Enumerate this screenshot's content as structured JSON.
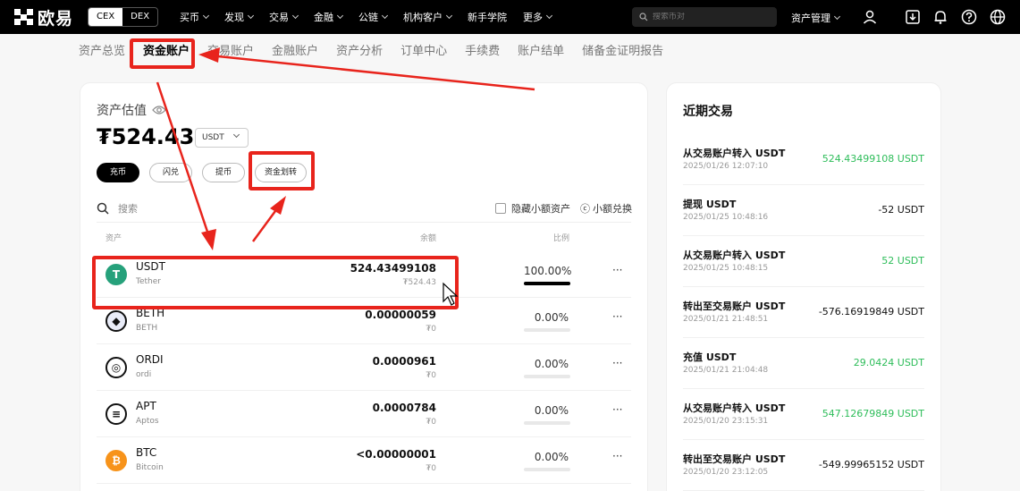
{
  "header": {
    "logo_text": "欧易",
    "cex_label": "CEX",
    "dex_label": "DEX",
    "nav": [
      "买币",
      "发现",
      "交易",
      "金融",
      "公链",
      "机构客户",
      "新手学院",
      "更多"
    ],
    "search_placeholder": "搜索币对",
    "asset_mgmt": "资产管理"
  },
  "subnav": [
    "资产总览",
    "资金账户",
    "交易账户",
    "金融账户",
    "资产分析",
    "订单中心",
    "手续费",
    "账户结单",
    "储备金证明报告"
  ],
  "subnav_active": "资金账户",
  "valuation": {
    "label": "资产估值",
    "amount": "₮524.43",
    "unit": "USDT"
  },
  "actions": {
    "deposit": "充币",
    "swap": "闪兑",
    "withdraw": "提币",
    "transfer": "资金划转"
  },
  "filters": {
    "search_placeholder": "搜索",
    "hide_small": "隐藏小额资产",
    "small_convert": "小额兑换"
  },
  "table": {
    "headers": [
      "资产",
      "余额",
      "比例"
    ],
    "rows": [
      {
        "symbol": "USDT",
        "name": "Tether",
        "amount": "524.43499108",
        "fiat": "₮524.43",
        "percent": "100.00%",
        "fill": 1.0,
        "color": "#26a17b",
        "glyph": "T",
        "icon": "tether-icon"
      },
      {
        "symbol": "BETH",
        "name": "BETH",
        "amount": "0.00000059",
        "fiat": "₮0",
        "percent": "0.00%",
        "fill": 0,
        "color": "#e9ecf8",
        "glyph": "◆",
        "icon": "eth-icon"
      },
      {
        "symbol": "ORDI",
        "name": "ordi",
        "amount": "0.0000961",
        "fiat": "₮0",
        "percent": "0.00%",
        "fill": 0,
        "color": "#ffffff",
        "glyph": "◎",
        "icon": "ordi-icon"
      },
      {
        "symbol": "APT",
        "name": "Aptos",
        "amount": "0.0000784",
        "fiat": "₮0",
        "percent": "0.00%",
        "fill": 0,
        "color": "#ffffff",
        "glyph": "≡",
        "icon": "aptos-icon"
      },
      {
        "symbol": "BTC",
        "name": "Bitcoin",
        "amount": "<0.00000001",
        "fiat": "₮0",
        "percent": "0.00%",
        "fill": 0,
        "color": "#f7931a",
        "glyph": "₿",
        "icon": "bitcoin-icon"
      }
    ],
    "more": "···"
  },
  "recent": {
    "title": "近期交易",
    "items": [
      {
        "title": "从交易账户转入 USDT",
        "time": "2025/01/26 12:07:10",
        "amount": "524.43499108 USDT",
        "positive": true
      },
      {
        "title": "提现 USDT",
        "time": "2025/01/25 10:48:16",
        "amount": "-52 USDT",
        "positive": false
      },
      {
        "title": "从交易账户转入 USDT",
        "time": "2025/01/25 10:48:15",
        "amount": "52 USDT",
        "positive": true
      },
      {
        "title": "转出至交易账户 USDT",
        "time": "2025/01/21 21:48:51",
        "amount": "-576.16919849 USDT",
        "positive": false
      },
      {
        "title": "充值 USDT",
        "time": "2025/01/21 21:04:48",
        "amount": "29.0424 USDT",
        "positive": true
      },
      {
        "title": "从交易账户转入 USDT",
        "time": "2025/01/20 23:15:31",
        "amount": "547.12679849 USDT",
        "positive": true
      },
      {
        "title": "转出至交易账户 USDT",
        "time": "2025/01/20 23:12:05",
        "amount": "-549.99965152 USDT",
        "positive": false
      }
    ]
  },
  "colors": {
    "annotation": "#e8241c",
    "positive": "#2ebd5a"
  }
}
